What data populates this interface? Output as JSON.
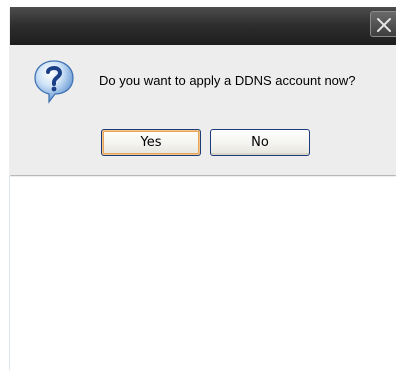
{
  "dialog": {
    "message": "Do you want to apply a DDNS account now?",
    "close_icon": "close-icon",
    "question_icon": "question-icon",
    "buttons": {
      "yes_label": "Yes",
      "no_label": "No"
    },
    "colors": {
      "titlebar": "#1d1d1d",
      "body": "#ededed",
      "focus_ring": "#e8a55a",
      "button_border": "#1c3b7a"
    }
  }
}
